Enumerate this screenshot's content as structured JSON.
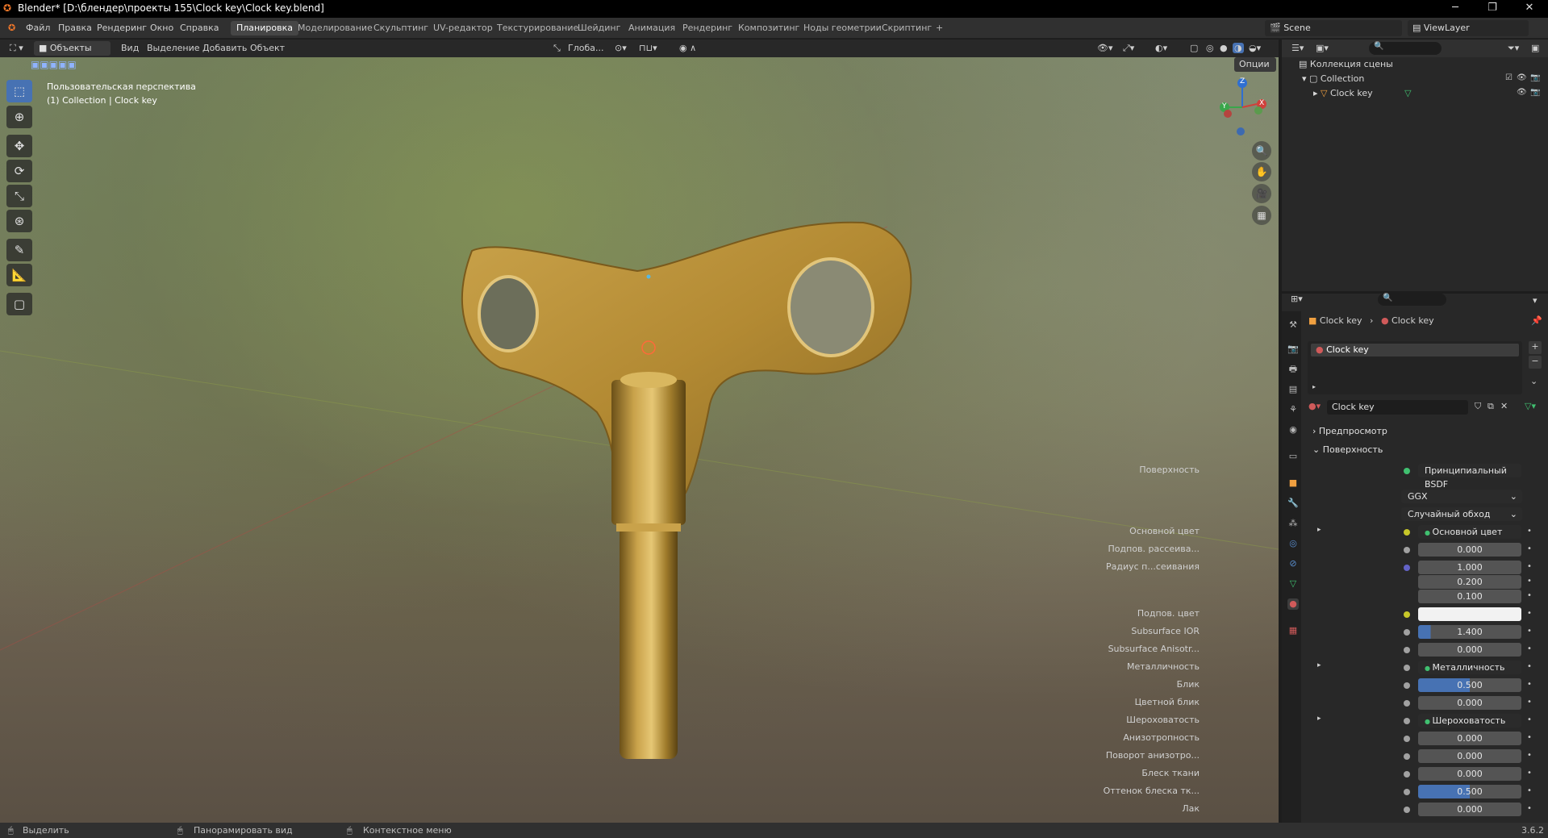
{
  "window": {
    "title": "Blender* [D:\\блендер\\проекты 155\\Clock key\\Clock key.blend]",
    "minimize": "─",
    "maximize": "❐",
    "close": "✕"
  },
  "menu": [
    "Файл",
    "Правка",
    "Рендеринг",
    "Окно",
    "Справка"
  ],
  "workspaces": [
    "Планировка",
    "Моделирование",
    "Скульптинг",
    "UV-редактор",
    "Текстурирование",
    "Шейдинг",
    "Анимация",
    "Рендеринг",
    "Композитинг",
    "Ноды геометрии",
    "Скриптинг",
    "+"
  ],
  "scene": {
    "name": "Scene",
    "view_layer": "ViewLayer"
  },
  "viewport_header": {
    "mode": "Объекты",
    "menus": [
      "Вид",
      "Выделение",
      "Добавить",
      "Объект"
    ],
    "transform": "Глоба...",
    "options": "Опции"
  },
  "viewport": {
    "perspective": "Пользовательская перспектива",
    "collection_info": "(1) Collection | Clock key",
    "gizmo": {
      "z": "Z",
      "y": "Y",
      "x": "X"
    }
  },
  "outliner": {
    "root": "Коллекция сцены",
    "collection": "Collection",
    "object": "Clock key"
  },
  "properties": {
    "breadcrumb_object": "Clock key",
    "breadcrumb_material": "Clock key",
    "slot": "Clock key",
    "material_name": "Clock key",
    "preview_section": "Предпросмотр",
    "surface_section": "Поверхность",
    "surface_label": "Поверхность",
    "surface_value": "Принципиальный BSDF",
    "distribution": "GGX",
    "subsurface_method": "Случайный обход",
    "rows": [
      {
        "label": "Основной цвет",
        "value": "Основной цвет",
        "kind": "link",
        "sock": "#c7c729",
        "arrow": true
      },
      {
        "label": "Подпов. рассеива...",
        "value": "0.000",
        "kind": "num",
        "sock": "#a1a1a1",
        "fill": 0
      },
      {
        "label": "Радиус п...сеивания",
        "value": "1.000",
        "kind": "num",
        "sock": "#6363c7",
        "fill": 0
      },
      {
        "label": "",
        "value": "0.200",
        "kind": "num",
        "sock": "",
        "fill": 0
      },
      {
        "label": "",
        "value": "0.100",
        "kind": "num",
        "sock": "",
        "fill": 0
      },
      {
        "label": "Подпов. цвет",
        "value": "",
        "kind": "color",
        "sock": "#c7c729"
      },
      {
        "label": "Subsurface IOR",
        "value": "1.400",
        "kind": "num",
        "sock": "#a1a1a1",
        "fill": 12
      },
      {
        "label": "Subsurface Anisotr...",
        "value": "0.000",
        "kind": "num",
        "sock": "#a1a1a1",
        "fill": 0
      },
      {
        "label": "Металличность",
        "value": "Металличность",
        "kind": "link",
        "sock": "#a1a1a1",
        "arrow": true
      },
      {
        "label": "Блик",
        "value": "0.500",
        "kind": "num",
        "sock": "#a1a1a1",
        "fill": 50
      },
      {
        "label": "Цветной блик",
        "value": "0.000",
        "kind": "num",
        "sock": "#a1a1a1",
        "fill": 0
      },
      {
        "label": "Шероховатость",
        "value": "Шероховатость",
        "kind": "link",
        "sock": "#a1a1a1",
        "arrow": true
      },
      {
        "label": "Анизотропность",
        "value": "0.000",
        "kind": "num",
        "sock": "#a1a1a1",
        "fill": 0
      },
      {
        "label": "Поворот анизотро...",
        "value": "0.000",
        "kind": "num",
        "sock": "#a1a1a1",
        "fill": 0
      },
      {
        "label": "Блеск ткани",
        "value": "0.000",
        "kind": "num",
        "sock": "#a1a1a1",
        "fill": 0
      },
      {
        "label": "Оттенок блеска тк...",
        "value": "0.500",
        "kind": "num",
        "sock": "#a1a1a1",
        "fill": 50
      },
      {
        "label": "Лак",
        "value": "0.000",
        "kind": "num",
        "sock": "#a1a1a1",
        "fill": 0
      }
    ]
  },
  "status": {
    "select": "Выделить",
    "pan": "Панорамировать вид",
    "context": "Контекстное меню",
    "version": "3.6.2"
  }
}
